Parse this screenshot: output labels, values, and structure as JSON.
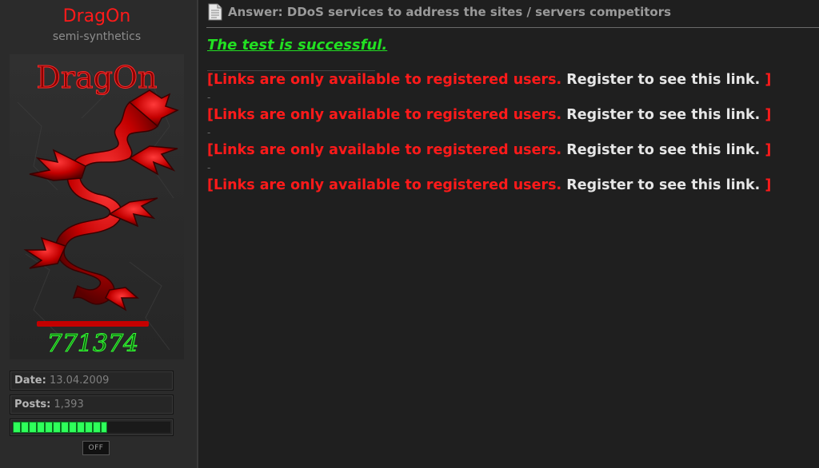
{
  "user": {
    "name": "DragOn",
    "title": "semi-synthetics",
    "signature_number": "771374"
  },
  "stats": {
    "date_label": "Date:",
    "date_value": "13.04.2009",
    "posts_label": "Posts:",
    "posts_value": "1,393",
    "reputation_fraction": 0.6
  },
  "off_button": "OFF",
  "post": {
    "title": "Answer: DDoS services to address the sites / servers competitors",
    "success_text": "The test is successful.",
    "separator": "-",
    "links": [
      {
        "open": "[Links are only available to registered users.",
        "register": "Register to see this link.",
        "close": "]"
      },
      {
        "open": "[Links are only available to registered users.",
        "register": "Register to see this link.",
        "close": "]"
      },
      {
        "open": "[Links are only available to registered users.",
        "register": "Register to see this link.",
        "close": "]"
      },
      {
        "open": "[Links are only available to registered users.",
        "register": "Register to see this link.",
        "close": "]"
      }
    ]
  },
  "colors": {
    "accent_red": "#ff1a1a",
    "success_green": "#22e022",
    "background": "#1f1f1f",
    "sidebar": "#2b2b2b"
  }
}
